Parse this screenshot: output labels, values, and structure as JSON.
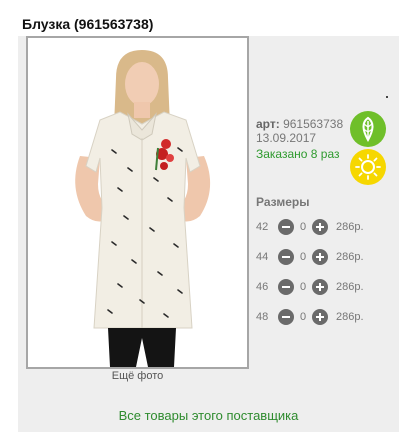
{
  "product": {
    "title": "Блузка (961563738)",
    "art_label": "арт:",
    "art_value": "961563738",
    "date": "13.09.2017",
    "ordered": "Заказано 8 раз",
    "more_photo": "Ещё фото",
    "supplier_link": "Все товары этого поставщика"
  },
  "badges": [
    "leaf-icon",
    "sun-icon"
  ],
  "sizes": {
    "title": "Размеры",
    "rows": [
      {
        "size": "42",
        "qty": "0",
        "price": "286р."
      },
      {
        "size": "44",
        "qty": "0",
        "price": "286р."
      },
      {
        "size": "46",
        "qty": "0",
        "price": "286р."
      },
      {
        "size": "48",
        "qty": "0",
        "price": "286р."
      }
    ]
  },
  "colors": {
    "accent_green": "#2e8b2e",
    "eco_green": "#6fbf2a",
    "sun_yellow": "#f6d700"
  }
}
